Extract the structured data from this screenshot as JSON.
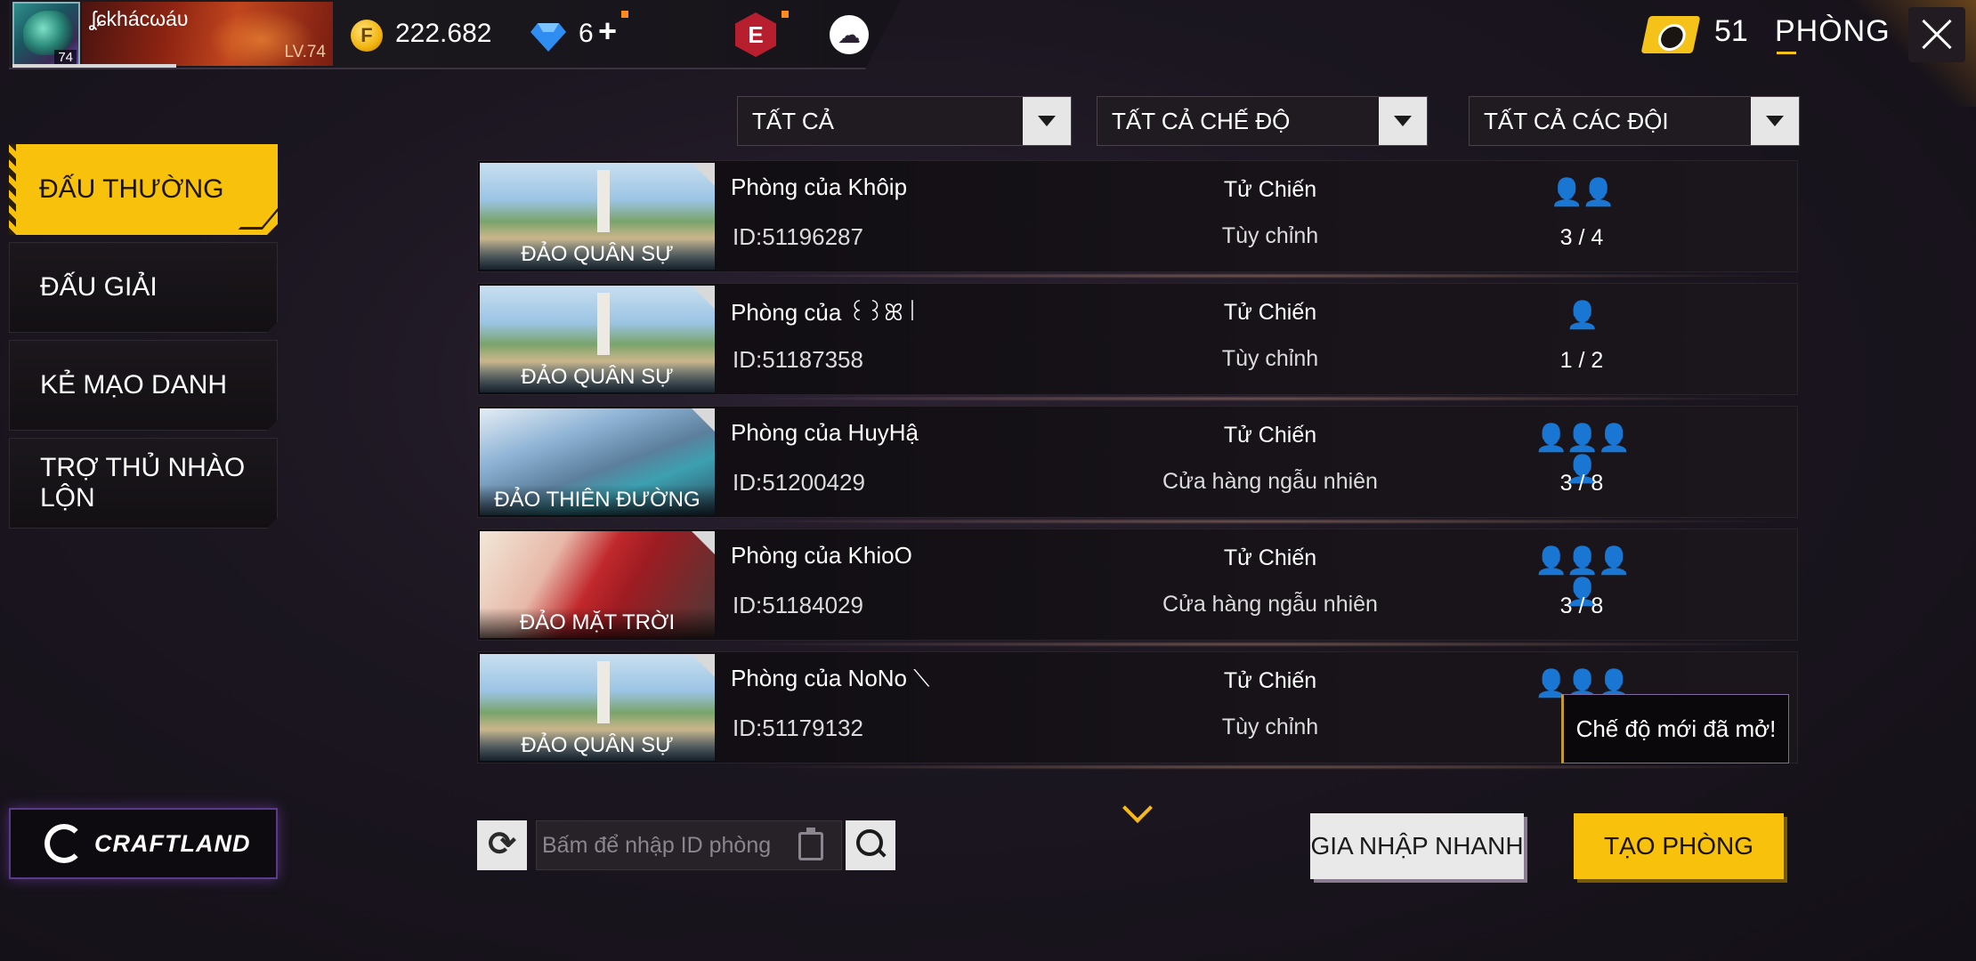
{
  "profile": {
    "name": "ʆɕkhácωáυ",
    "avatar_level": "74",
    "level_label": "LV.74"
  },
  "currency": {
    "gold": "222.682",
    "diamonds": "6",
    "diamond_plus": "+"
  },
  "icons": {
    "elite_pass": "E"
  },
  "header": {
    "ticket_count": "51",
    "title": "PHÒNG"
  },
  "filters": {
    "all": "TẤT CẢ",
    "all_modes": "TẤT CẢ CHẾ ĐỘ",
    "all_teams": "TẤT CẢ CÁC ĐỘI"
  },
  "sidebar": {
    "items": [
      {
        "label": "ĐẤU THƯỜNG",
        "active": true
      },
      {
        "label": "ĐẤU GIẢI",
        "active": false
      },
      {
        "label": "KẺ MẠO DANH",
        "active": false
      },
      {
        "label": "TRỢ THỦ NHÀO LỘN",
        "active": false
      }
    ],
    "craftland": "CRAFTLAND"
  },
  "rooms": [
    {
      "map": "ĐẢO QUÂN SỰ",
      "name": "Phòng của Khôip",
      "id": "ID:51196287",
      "mode": "Tử Chiến",
      "sub": "Tùy chỉnh",
      "team_icons": "👤👤",
      "count": "3 / 4"
    },
    {
      "map": "ĐẢO QUÂN SỰ",
      "name": "Phòng của ꒰꒱ꕤ꒐",
      "id": "ID:51187358",
      "mode": "Tử Chiến",
      "sub": "Tùy chỉnh",
      "team_icons": "👤",
      "count": "1 / 2"
    },
    {
      "map": "ĐẢO THIÊN ĐƯỜNG",
      "name": "Phòng của HuyHậ",
      "id": "ID:51200429",
      "mode": "Tử Chiến",
      "sub": "Cửa hàng ngẫu nhiên",
      "team_icons": "👤👤👤👤",
      "count": "3 / 8"
    },
    {
      "map": "ĐẢO MẶT TRỜI",
      "name": "Phòng của KhioO",
      "id": "ID:51184029",
      "mode": "Tử Chiến",
      "sub": "Cửa hàng ngẫu nhiên",
      "team_icons": "👤👤👤👤",
      "count": "3 / 8"
    },
    {
      "map": "ĐẢO QUÂN SỰ",
      "name": "Phòng của NoNo ⟍",
      "id": "ID:51179132",
      "mode": "Tử Chiến",
      "sub": "Tùy chỉnh",
      "team_icons": "👤👤👤👤",
      "count": "3"
    }
  ],
  "tooltip": "Chế độ mới đã mở!",
  "search": {
    "placeholder": "Bấm để nhập ID phòng"
  },
  "buttons": {
    "quick_join": "GIA NHẬP NHANH",
    "create_room": "TẠO PHÒNG"
  }
}
